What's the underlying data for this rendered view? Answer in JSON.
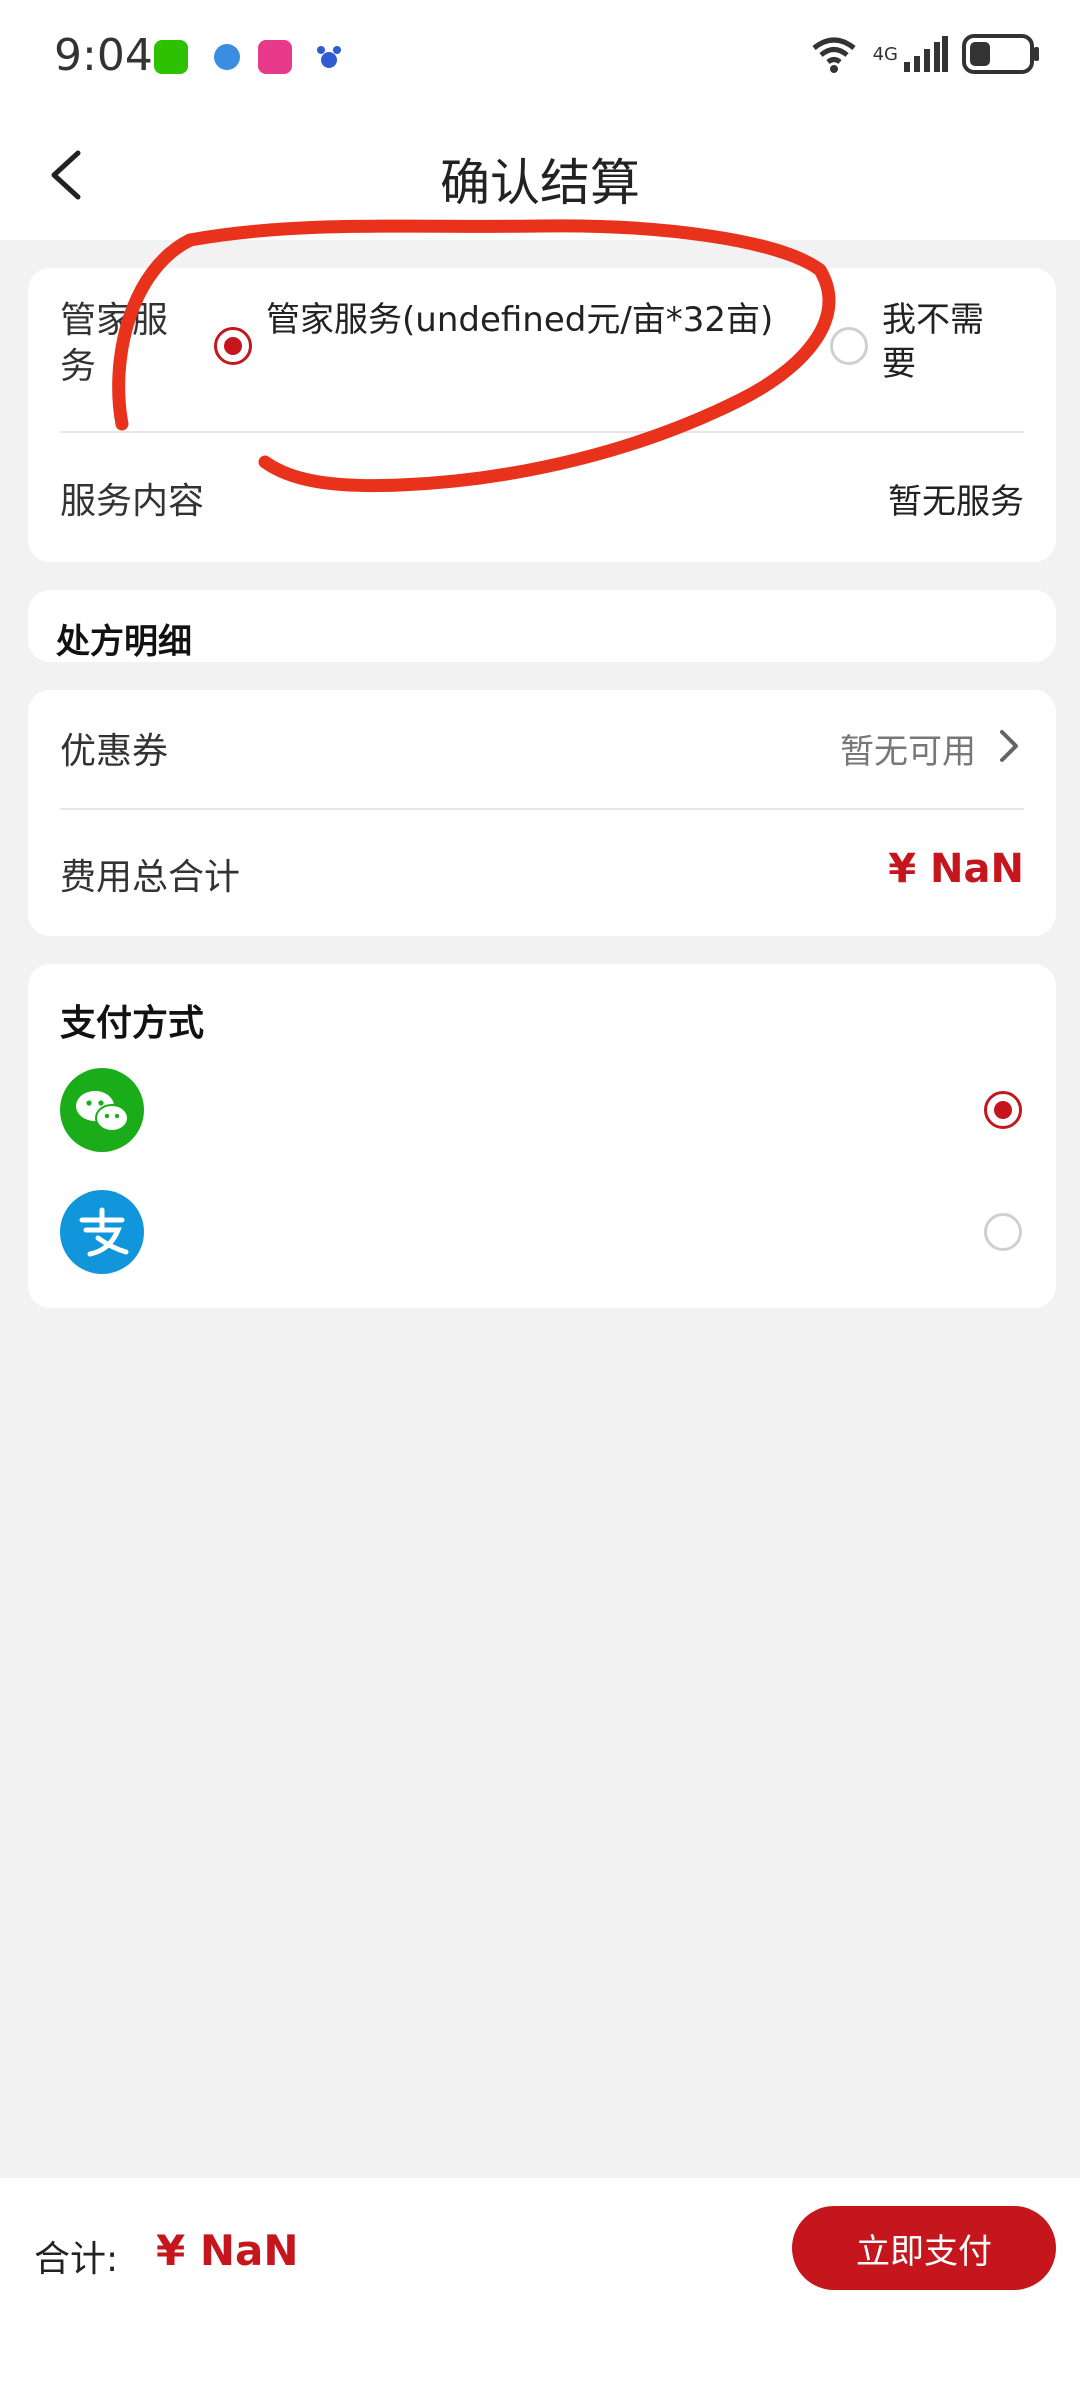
{
  "status_bar": {
    "time": "9:04",
    "network": "4G"
  },
  "header": {
    "title": "确认结算"
  },
  "butler": {
    "label": "管家服务",
    "option_selected": "管家服务(undefined元/亩*32亩)",
    "option_none": "我不需要",
    "content_label": "服务内容",
    "content_value": "暂无服务"
  },
  "prescription": {
    "title": "处方明细"
  },
  "summary": {
    "coupon_label": "优惠券",
    "coupon_value": "暂无可用",
    "total_label": "费用总合计",
    "total_value": "¥ NaN"
  },
  "payment": {
    "title": "支付方式",
    "methods": [
      {
        "name": "wechat-pay",
        "selected": true
      },
      {
        "name": "alipay",
        "selected": false
      }
    ]
  },
  "footer": {
    "sum_label": "合计:",
    "sum_value": "¥ NaN",
    "pay_button": "立即支付"
  },
  "colors": {
    "accent": "#c4161c",
    "wechat": "#1aad19",
    "alipay": "#1296db"
  }
}
